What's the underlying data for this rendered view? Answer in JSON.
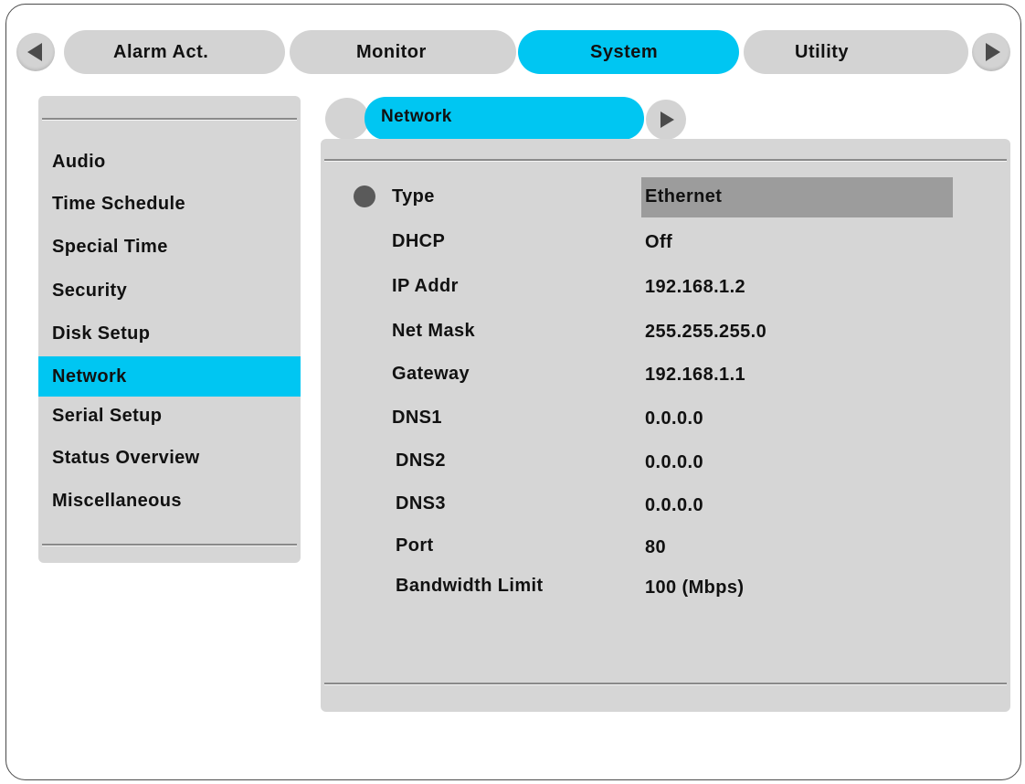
{
  "top_tabs": {
    "items": [
      "Alarm Act.",
      "Monitor",
      "System",
      "Utility"
    ],
    "active": "System"
  },
  "left_menu": {
    "items": [
      "Audio",
      "Time Schedule",
      "Special Time",
      "Security",
      "Disk Setup",
      "Network",
      "Serial Setup",
      "Status Overview",
      "Miscellaneous"
    ],
    "active": "Network"
  },
  "sub_tab": {
    "label": "Network"
  },
  "settings": {
    "rows": [
      {
        "label": "Type",
        "value": "Ethernet"
      },
      {
        "label": "DHCP",
        "value": "Off"
      },
      {
        "label": "IP Addr",
        "value": "192.168.1.2"
      },
      {
        "label": "Net Mask",
        "value": "255.255.255.0"
      },
      {
        "label": "Gateway",
        "value": "192.168.1.1"
      },
      {
        "label": "DNS1",
        "value": "0.0.0.0"
      },
      {
        "label": "DNS2",
        "value": "0.0.0.0"
      },
      {
        "label": "DNS3",
        "value": "0.0.0.0"
      },
      {
        "label": "Port",
        "value": "80"
      },
      {
        "label": "Bandwidth Limit",
        "value": "100 (Mbps)"
      }
    ],
    "selected": "Type"
  },
  "colors": {
    "accent": "#00c6f2",
    "panel": "#d6d6d6",
    "selection": "#9c9c9c"
  },
  "icons": {
    "prev": "triangle-left-icon",
    "next": "triangle-right-icon",
    "sub_next": "triangle-right-icon",
    "bullet": "circle-bullet-icon"
  }
}
